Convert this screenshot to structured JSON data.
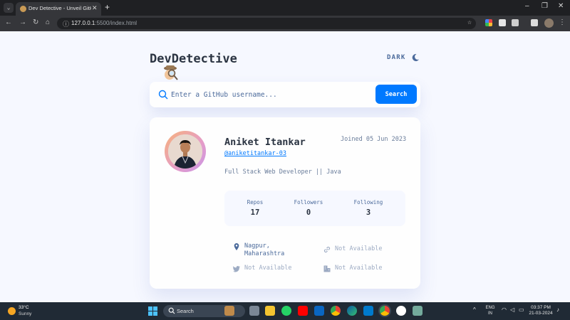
{
  "browser": {
    "tab_title": "Dev Detective - Unveil GitHub P",
    "url_host": "127.0.0.1",
    "url_rest": ":5500/index.html"
  },
  "app": {
    "brand": "DevDetective",
    "theme_toggle_label": "DARK",
    "search": {
      "placeholder": "Enter a GitHub username...",
      "value": "",
      "button_label": "Search"
    },
    "profile": {
      "name": "Aniket Itankar",
      "joined": "Joined 05 Jun 2023",
      "handle": "@aniketitankar-03",
      "bio": "Full Stack Web Developer || Java",
      "stats": [
        {
          "label": "Repos",
          "value": "17"
        },
        {
          "label": "Followers",
          "value": "0"
        },
        {
          "label": "Following",
          "value": "3"
        }
      ],
      "links": {
        "location": "Nagpur,\nMaharashtra",
        "website": "Not Available",
        "twitter": "Not Available",
        "company": "Not Available"
      }
    }
  },
  "taskbar": {
    "weather_temp": "33°C",
    "weather_condition": "Sunny",
    "search_label": "Search",
    "lang_line1": "ENG",
    "lang_line2": "IN",
    "time": "03:37 PM",
    "date": "21-03-2024"
  },
  "colors": {
    "accent": "#0079ff",
    "heading": "#2b3442",
    "muted": "#697c9a",
    "page_bg": "#f6f8ff"
  }
}
